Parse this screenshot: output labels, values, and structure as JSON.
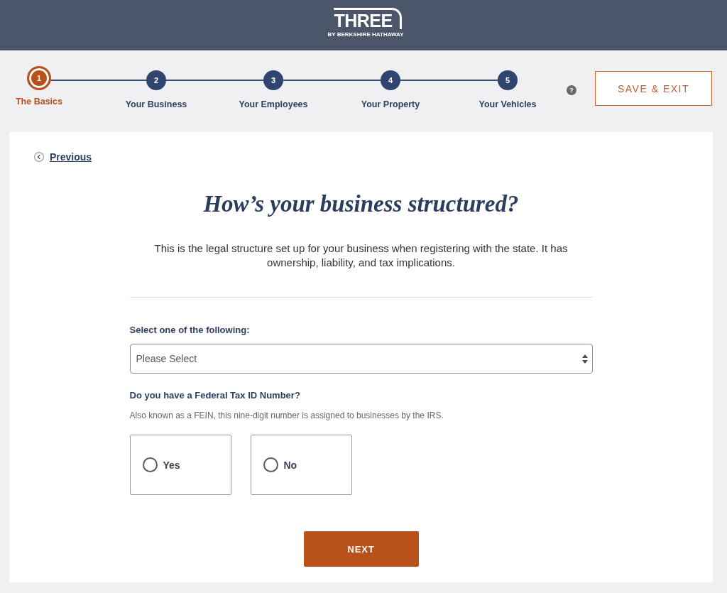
{
  "header": {
    "logo": {
      "name": "THREE",
      "tagline": "BY BERKSHIRE HATHAWAY"
    }
  },
  "progress": {
    "steps": [
      {
        "number": "1",
        "label": "The Basics",
        "selected": true
      },
      {
        "number": "2",
        "label": "Your Business",
        "selected": false
      },
      {
        "number": "3",
        "label": "Your Employees",
        "selected": false
      },
      {
        "number": "4",
        "label": "Your Property",
        "selected": false
      },
      {
        "number": "5",
        "label": "Your Vehicles",
        "selected": false
      }
    ],
    "help": "?",
    "save_button": "SAVE & EXIT"
  },
  "form": {
    "back_link": "Previous",
    "title": "How’s your business structured?",
    "description": "This is the legal structure set up for your business when registering with the state. It has ownership, liability, and tax implications.",
    "questions": [
      {
        "kind": "select",
        "label": "Select one of the following:",
        "placeholder": "Please Select"
      },
      {
        "kind": "radio",
        "label": "Do you have a Federal Tax ID Number?",
        "hint": "Also known as a FEIN, this nine-digit number is assigned to businesses by the IRS.",
        "options": [
          {
            "label": "Yes",
            "selected": false
          },
          {
            "label": "No",
            "selected": false
          }
        ]
      }
    ],
    "next_button": "NEXT"
  }
}
